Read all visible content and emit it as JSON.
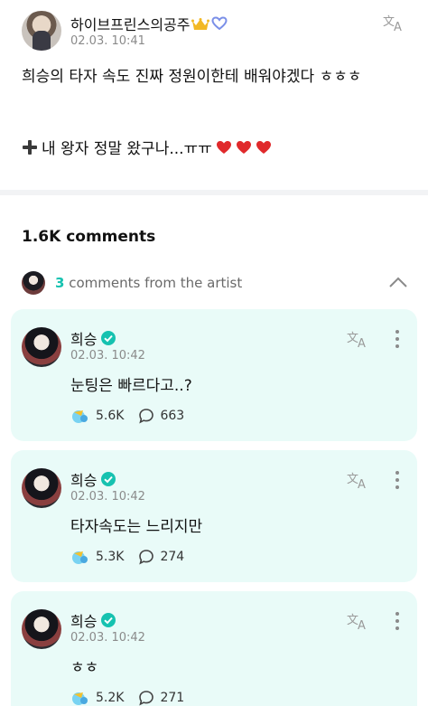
{
  "post": {
    "author": "하이브프린스의공주",
    "date": "02.03. 10:41",
    "line1": "희승의 타자 속도 진짜 정원이한테 배워야겠다 ㅎㅎㅎ",
    "line2": "내 왕자 정말 왔구나...ㅠㅠ",
    "colors": {
      "heart": "#e0292b",
      "heart_outline": "#7a8fe8",
      "crown": "#f2b824"
    }
  },
  "comments_section": {
    "count_label": "1.6K comments",
    "artist_bar": {
      "count": "3",
      "label": "comments from the artist"
    }
  },
  "comments": [
    {
      "name": "희승",
      "date": "02.03. 10:42",
      "text": "눈팅은 빠르다고..?",
      "cheers": "5.6K",
      "replies": "663"
    },
    {
      "name": "희승",
      "date": "02.03. 10:42",
      "text": "타자속도는 느리지만",
      "cheers": "5.3K",
      "replies": "274"
    },
    {
      "name": "희승",
      "date": "02.03. 10:42",
      "text": "ㅎㅎ",
      "cheers": "5.2K",
      "replies": "271"
    }
  ],
  "colors": {
    "accent": "#16c2b0",
    "card_bg": "#e9fbf8",
    "verified": "#16c2b0"
  }
}
